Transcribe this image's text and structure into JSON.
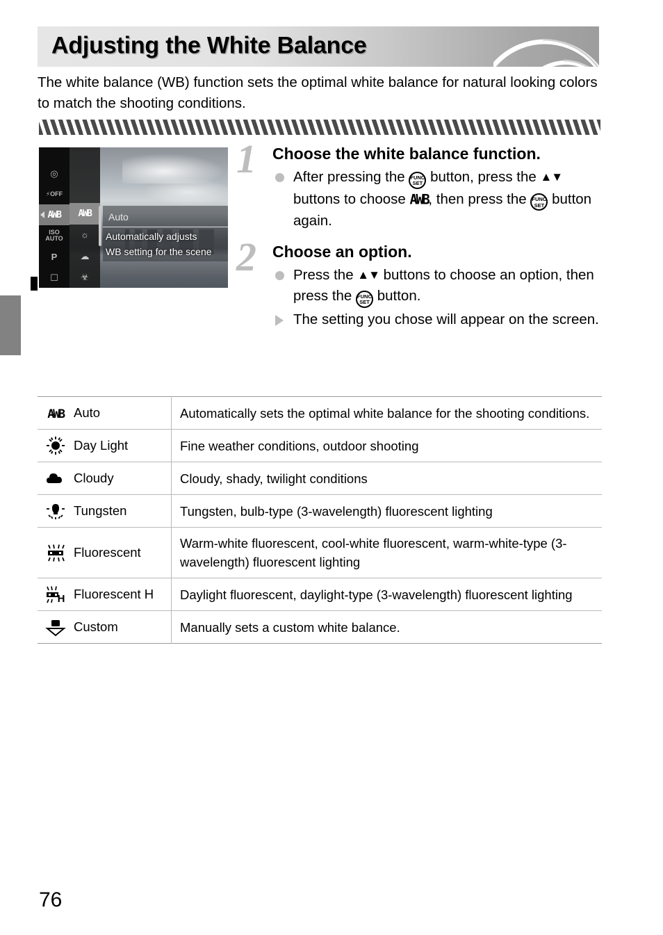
{
  "page": {
    "number": "76",
    "title": "Adjusting the White Balance",
    "intro": "The white balance (WB) function sets the optimal white balance for natural looking colors to match the shooting conditions."
  },
  "lcd": {
    "menu_column_items": [
      "metering-icon",
      "flash-off-icon",
      "AWB",
      "ISO AUTO",
      "P",
      "drive-icon"
    ],
    "iso_label_top": "ISO",
    "iso_label_bottom": "AUTO",
    "mode_label": "P",
    "awb_label": "AWB",
    "option_column_items": [
      "AWB",
      "daylight-icon",
      "cloudy-icon",
      "tungsten-icon"
    ],
    "panel_title": "Auto",
    "panel_line1": "Automatically adjusts",
    "panel_line2": "WB setting for the scene"
  },
  "steps": [
    {
      "number": "1",
      "heading": "Choose the white balance function.",
      "bullets": [
        {
          "marker": "dot",
          "parts": [
            {
              "t": "text",
              "v": "After pressing the "
            },
            {
              "t": "func"
            },
            {
              "t": "text",
              "v": " button, press the "
            },
            {
              "t": "updown"
            },
            {
              "t": "text",
              "v": " buttons to choose "
            },
            {
              "t": "awb"
            },
            {
              "t": "text",
              "v": ", then press the "
            },
            {
              "t": "func"
            },
            {
              "t": "text",
              "v": " button again."
            }
          ]
        }
      ]
    },
    {
      "number": "2",
      "heading": "Choose an option.",
      "bullets": [
        {
          "marker": "dot",
          "parts": [
            {
              "t": "text",
              "v": "Press the "
            },
            {
              "t": "updown"
            },
            {
              "t": "text",
              "v": " buttons to choose an option, then press the "
            },
            {
              "t": "func"
            },
            {
              "t": "text",
              "v": " button."
            }
          ]
        },
        {
          "marker": "triangle",
          "parts": [
            {
              "t": "text",
              "v": "The setting you chose will appear on the screen."
            }
          ]
        }
      ]
    }
  ],
  "func_button": {
    "line1": "FUNC.",
    "line2": "SET"
  },
  "table": {
    "rows": [
      {
        "icon": "awb-icon",
        "name": "Auto",
        "desc": "Automatically sets the optimal white balance for the shooting conditions."
      },
      {
        "icon": "daylight-icon",
        "name": "Day Light",
        "desc": "Fine weather conditions, outdoor shooting"
      },
      {
        "icon": "cloudy-icon",
        "name": "Cloudy",
        "desc": "Cloudy, shady, twilight conditions"
      },
      {
        "icon": "tungsten-icon",
        "name": "Tungsten",
        "desc": "Tungsten, bulb-type (3-wavelength) fluorescent lighting"
      },
      {
        "icon": "fluorescent-icon",
        "name": "Fluorescent",
        "desc": "Warm-white fluorescent, cool-white fluorescent, warm-white-type (3-wavelength) fluorescent lighting"
      },
      {
        "icon": "fluorescent-h-icon",
        "name": "Fluorescent H",
        "desc": "Daylight fluorescent, daylight-type (3-wavelength) fluorescent lighting"
      },
      {
        "icon": "custom-wb-icon",
        "name": "Custom",
        "desc": "Manually sets a custom white balance."
      }
    ]
  },
  "colors": {
    "banner_light": "#e6e6e6",
    "banner_dark": "#9d9d9d",
    "rule_dark": "#4a4a4a",
    "marker_gray": "#bdbdbd",
    "tab_gray": "#828282"
  }
}
